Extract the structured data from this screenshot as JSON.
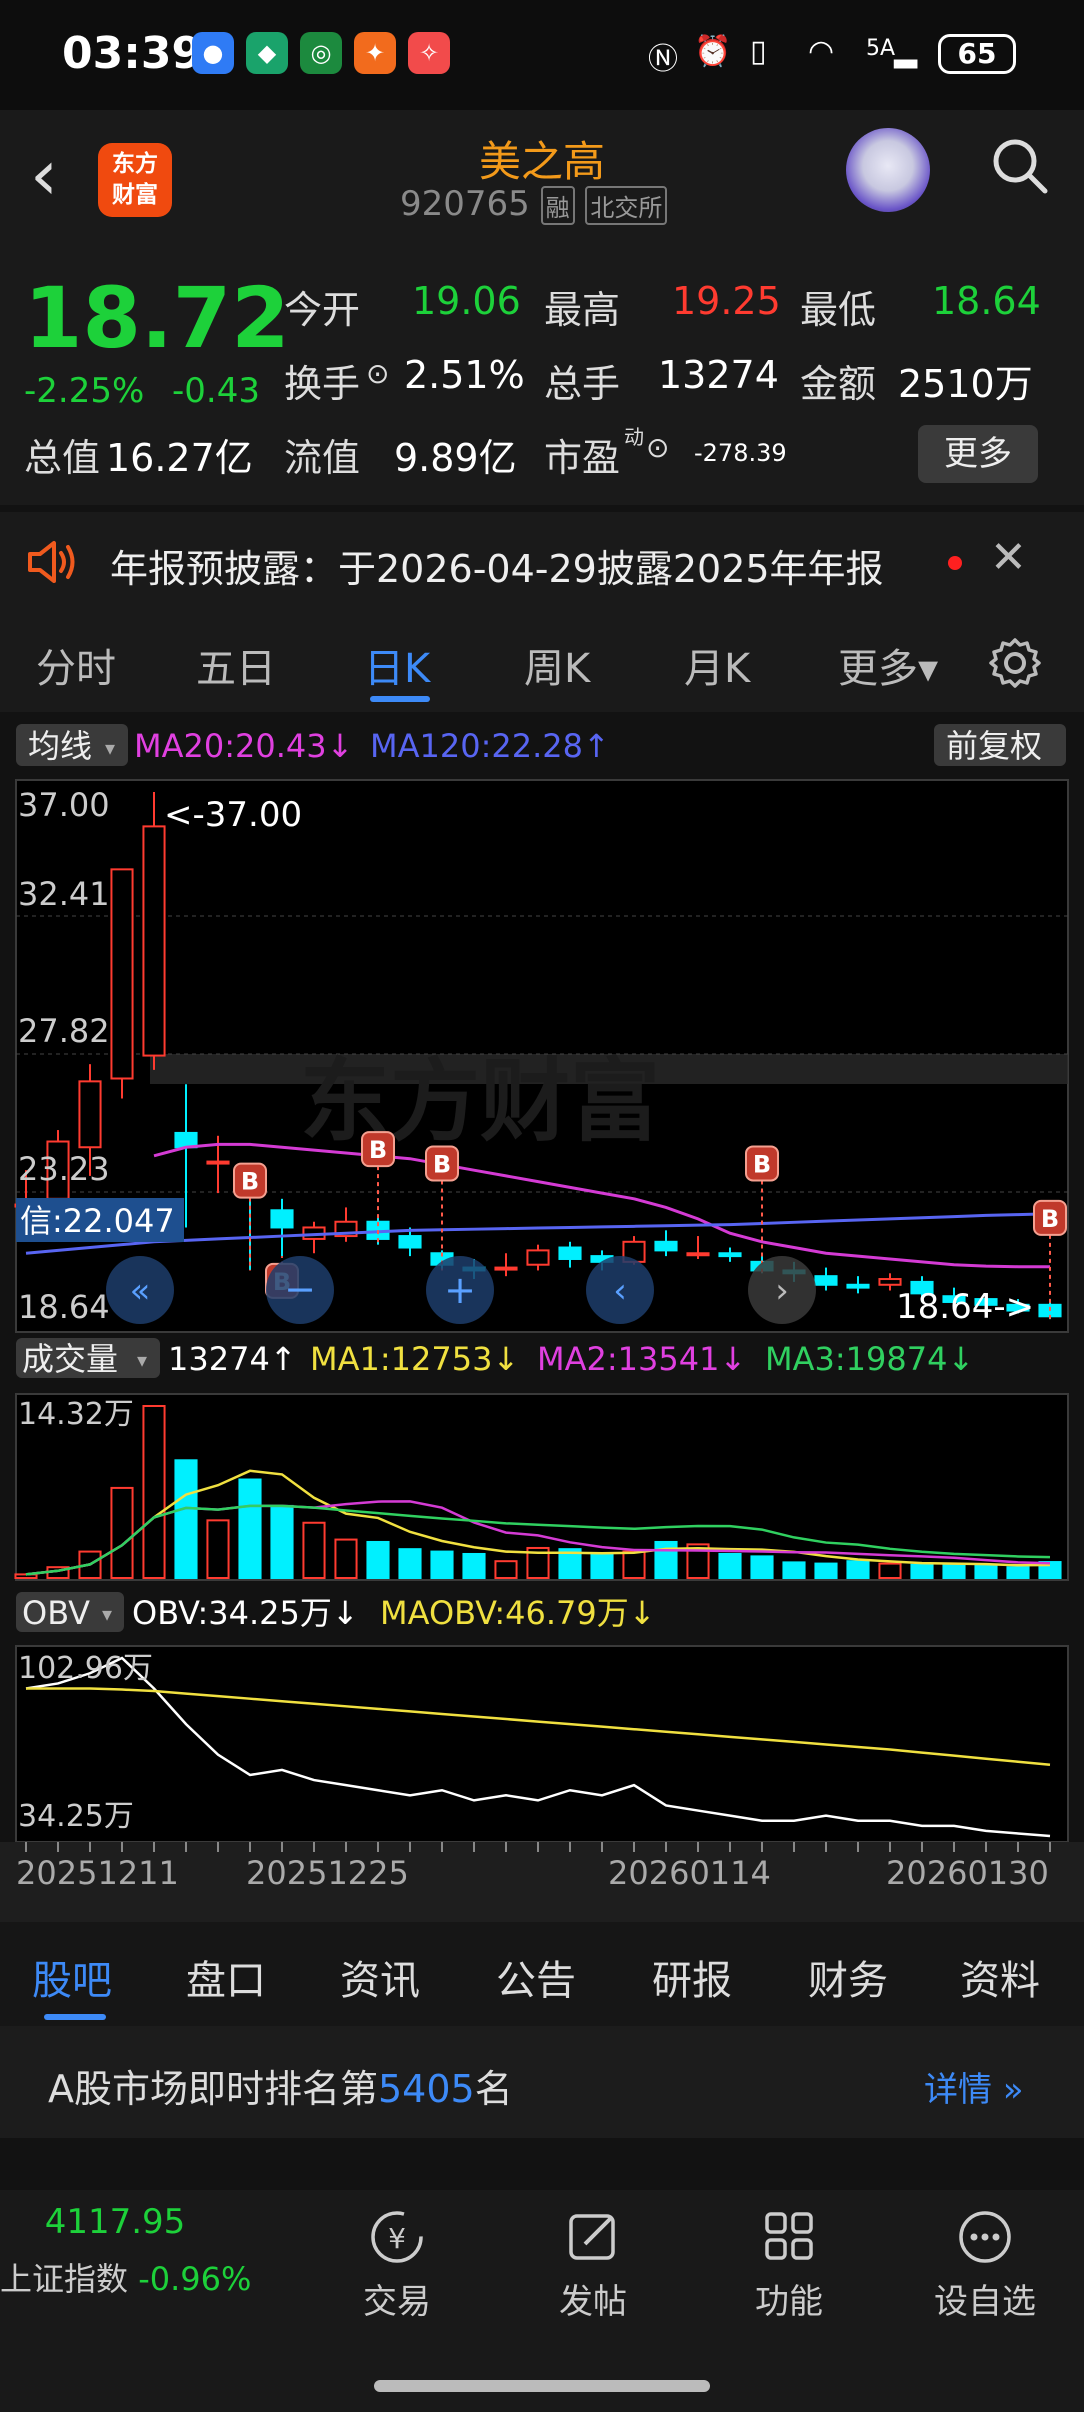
{
  "status_bar": {
    "time": "03:39",
    "battery": "65",
    "network": "5A"
  },
  "header": {
    "stock_name": "美之高",
    "stock_code": "920765",
    "tag_margin": "融",
    "tag_exchange": "北交所",
    "logo_text": "东方财富"
  },
  "quote": {
    "price": "18.72",
    "change_pct": "-2.25%",
    "change": "-0.43",
    "open_label": "今开",
    "open": "19.06",
    "high_label": "最高",
    "high": "19.25",
    "low_label": "最低",
    "low": "18.64",
    "turnover_label": "换手",
    "turnover": "2.51%",
    "volume_label": "总手",
    "volume": "13274",
    "amount_label": "金额",
    "amount": "2510万",
    "mktcap_label": "总值",
    "mktcap": "16.27亿",
    "float_label": "流值",
    "float": "9.89亿",
    "pe_label": "市盈",
    "pe_sup": "动",
    "pe": "-278.39",
    "more_button": "更多"
  },
  "notice": {
    "text": "年报预披露：于2026-04-29披露2025年年报"
  },
  "chart_tabs": [
    "分时",
    "五日",
    "日K",
    "周K",
    "月K",
    "更多▾"
  ],
  "active_tab": "日K",
  "chart_data": {
    "type": "candlestick",
    "indicator_label": "均线",
    "ma20": "MA20:20.43",
    "ma120": "MA120:22.28",
    "adjust_button": "前复权",
    "price_ticks": [
      "37.00",
      "32.41",
      "27.82",
      "23.23",
      "18.64"
    ],
    "max_marker": "<-37.00",
    "min_marker": "18.64->",
    "crosshair_label": "信:22.047",
    "ylim": [
      18.64,
      37.0
    ],
    "candles": [
      {
        "o": 22.6,
        "h": 23.8,
        "l": 22.0,
        "c": 22.6
      },
      {
        "o": 22.8,
        "h": 25.2,
        "l": 22.4,
        "c": 24.8
      },
      {
        "o": 24.6,
        "h": 27.5,
        "l": 23.6,
        "c": 26.9
      },
      {
        "o": 27.0,
        "h": 34.3,
        "l": 26.3,
        "c": 34.3
      },
      {
        "o": 27.8,
        "h": 37.0,
        "l": 27.3,
        "c": 35.8
      },
      {
        "o": 25.1,
        "h": 26.8,
        "l": 21.8,
        "c": 24.6
      },
      {
        "o": 24.1,
        "h": 25.0,
        "l": 23.0,
        "c": 24.1
      },
      {
        "o": 23.6,
        "h": 23.6,
        "l": 20.3,
        "c": 22.9
      },
      {
        "o": 22.4,
        "h": 22.8,
        "l": 20.8,
        "c": 21.8
      },
      {
        "o": 21.4,
        "h": 22.0,
        "l": 20.9,
        "c": 21.8
      },
      {
        "o": 21.5,
        "h": 22.5,
        "l": 21.3,
        "c": 22.0
      },
      {
        "o": 22.0,
        "h": 22.2,
        "l": 21.2,
        "c": 21.4
      },
      {
        "o": 21.5,
        "h": 21.8,
        "l": 20.8,
        "c": 21.1
      },
      {
        "o": 20.9,
        "h": 21.0,
        "l": 20.3,
        "c": 20.5
      },
      {
        "o": 20.4,
        "h": 20.7,
        "l": 20.0,
        "c": 20.3
      },
      {
        "o": 20.4,
        "h": 20.9,
        "l": 20.1,
        "c": 20.4
      },
      {
        "o": 20.5,
        "h": 21.2,
        "l": 20.3,
        "c": 21.0
      },
      {
        "o": 21.1,
        "h": 21.3,
        "l": 20.4,
        "c": 20.7
      },
      {
        "o": 20.8,
        "h": 21.0,
        "l": 20.3,
        "c": 20.6
      },
      {
        "o": 20.6,
        "h": 21.5,
        "l": 20.5,
        "c": 21.3
      },
      {
        "o": 21.3,
        "h": 21.7,
        "l": 20.8,
        "c": 21.0
      },
      {
        "o": 20.9,
        "h": 21.5,
        "l": 20.7,
        "c": 20.9
      },
      {
        "o": 20.9,
        "h": 21.1,
        "l": 20.6,
        "c": 20.8
      },
      {
        "o": 20.6,
        "h": 20.8,
        "l": 20.2,
        "c": 20.3
      },
      {
        "o": 20.3,
        "h": 20.6,
        "l": 19.9,
        "c": 20.2
      },
      {
        "o": 20.1,
        "h": 20.4,
        "l": 19.6,
        "c": 19.8
      },
      {
        "o": 19.8,
        "h": 20.1,
        "l": 19.5,
        "c": 19.7
      },
      {
        "o": 19.8,
        "h": 20.2,
        "l": 19.6,
        "c": 20.0
      },
      {
        "o": 19.9,
        "h": 20.1,
        "l": 19.2,
        "c": 19.5
      },
      {
        "o": 19.4,
        "h": 19.7,
        "l": 18.9,
        "c": 19.2
      },
      {
        "o": 19.3,
        "h": 19.5,
        "l": 18.9,
        "c": 19.1
      },
      {
        "o": 19.1,
        "h": 19.3,
        "l": 18.8,
        "c": 18.9
      },
      {
        "o": 19.1,
        "h": 19.3,
        "l": 18.6,
        "c": 18.7
      }
    ],
    "ma20_line": [
      null,
      null,
      null,
      null,
      24.3,
      24.6,
      24.7,
      24.7,
      24.6,
      24.5,
      24.4,
      24.3,
      24.2,
      24.0,
      23.8,
      23.6,
      23.4,
      23.2,
      23.0,
      22.8,
      22.5,
      22.1,
      21.6,
      21.3,
      21.1,
      20.9,
      20.8,
      20.7,
      20.6,
      20.5,
      20.45,
      20.43,
      20.43
    ],
    "ma120_line": [
      20.9,
      21.0,
      21.1,
      21.2,
      21.3,
      21.35,
      21.4,
      21.45,
      21.5,
      21.55,
      21.6,
      21.65,
      21.7,
      21.72,
      21.74,
      21.76,
      21.78,
      21.8,
      21.82,
      21.84,
      21.86,
      21.88,
      21.9,
      21.94,
      21.98,
      22.02,
      22.06,
      22.1,
      22.14,
      22.18,
      22.22,
      22.25,
      22.28
    ],
    "b_markers": [
      {
        "i": 7,
        "p": 23.4
      },
      {
        "i": 8,
        "p": 19.9
      },
      {
        "i": 11,
        "p": 24.5
      },
      {
        "i": 13,
        "p": 24.0
      },
      {
        "i": 23,
        "p": 24.0
      },
      {
        "i": 32,
        "p": 22.1
      }
    ],
    "volume": {
      "label": "成交量",
      "value": "13274",
      "ma1": "MA1:12753",
      "ma2": "MA2:13541",
      "ma3": "MA3:19874",
      "top_tick": "14.32万",
      "max": 143200,
      "bars": [
        3000,
        9000,
        22000,
        75000,
        143200,
        98000,
        48000,
        82000,
        60000,
        46000,
        32000,
        30000,
        24000,
        22000,
        20000,
        14000,
        25000,
        24000,
        20000,
        22000,
        30000,
        28000,
        20000,
        18000,
        13000,
        12000,
        14000,
        12000,
        11000,
        11000,
        10000,
        9000,
        13274
      ]
    },
    "obv": {
      "label": "OBV",
      "value": "OBV:34.25万",
      "maobv": "MAOBV:46.79万",
      "top_tick": "102.96万",
      "bottom_tick": "34.25万",
      "obv_line": [
        97,
        98,
        100,
        103,
        97,
        90,
        84,
        80,
        81,
        79,
        78,
        77,
        76,
        77,
        75,
        76,
        75,
        77,
        76,
        78,
        74,
        73,
        72,
        71,
        71,
        72,
        71,
        71,
        70,
        70,
        69,
        68.5,
        68
      ],
      "maobv_line": [
        97,
        97,
        97,
        96.8,
        96.5,
        96,
        95.5,
        95,
        94.5,
        94,
        93.5,
        93,
        92.5,
        92,
        91.5,
        91,
        90.5,
        90,
        89.5,
        89,
        88.5,
        88,
        87.5,
        87,
        86.5,
        86,
        85.5,
        85,
        84.4,
        83.8,
        83.2,
        82.6,
        82
      ]
    },
    "x_labels": [
      "20251211",
      "20251225",
      "20260114",
      "20260130"
    ]
  },
  "bottom_tabs": [
    "股吧",
    "盘口",
    "资讯",
    "公告",
    "研报",
    "财务",
    "资料"
  ],
  "active_bottom_tab": "股吧",
  "rank": {
    "prefix": "A股市场即时排名第",
    "value": "5405",
    "suffix": "名",
    "detail": "详情"
  },
  "nav": {
    "index_value": "4117.95",
    "index_name": "上证指数",
    "index_change": "-0.96%",
    "items": [
      "交易",
      "发帖",
      "功能",
      "设自选"
    ]
  }
}
